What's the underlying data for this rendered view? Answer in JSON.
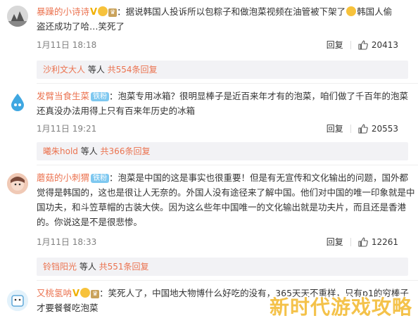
{
  "comments": [
    {
      "username": "暴躁的小诗诗",
      "content_line1": "：据说韩国人投诉所以包粽子和做泡菜视频在油管被下架了",
      "content_line1_tail": "韩国人偷",
      "content_line2": "盗还成功了哈…笑死了",
      "time": "1月11日 18:18",
      "reply_label": "回复",
      "likes": "20413",
      "reply_user": "沙利文大人",
      "reply_mid": " 等人 ",
      "reply_more": "共554条回复"
    },
    {
      "username": "发臂当食生菜",
      "badge": "铁粉",
      "content_line1": "：泡菜专用冰箱？很明显棒子是近百来年才有的泡菜，咱们做了千百年的泡菜",
      "content_line2": "还真没办法用得上只有百来年历史的冰箱",
      "time": "1月11日 19:21",
      "reply_label": "回复",
      "likes": "20553",
      "reply_user": "曦朱hold",
      "reply_mid": " 等人 ",
      "reply_more": "共366条回复"
    },
    {
      "username": "蘑菇的小刺猬",
      "badge": "铁粉",
      "content_line1": "：泡菜是中国的这是事实也很重要！但是有无宣传和文化输出的问题，国外都",
      "content_line2": "觉得是韩国的，这也是很让人无奈的。外国人没有途径来了解中国。他们对中国的唯一印象就是中",
      "content_line3": "国功夫，和斗笠草帽的古装大侠。因为这么些年中国唯一的文化输出就是功夫片，而且还是香港",
      "content_line4": "的。你说这是不是很悲惨。",
      "time": "1月11日 18:33",
      "reply_label": "回复",
      "likes": "12261",
      "reply_user": "铃铛阳光",
      "reply_mid": " 等人 ",
      "reply_more": "共551条回复"
    },
    {
      "username": "又桃氢呐",
      "content_line1": "：笑死人了，中国地大物博什么好吃的没有，365天天不重样，只有p1的穷棒子",
      "content_line2": "才要餐餐吃泡菜"
    }
  ],
  "watermark": "新时代游戏攻略",
  "colors": {
    "accent": "#eb7350",
    "badge": "#7ec8f0",
    "reply_bg": "#f2f2f5"
  },
  "icons": {
    "like": "thumbs-up-icon",
    "vip": "crown-icon"
  }
}
